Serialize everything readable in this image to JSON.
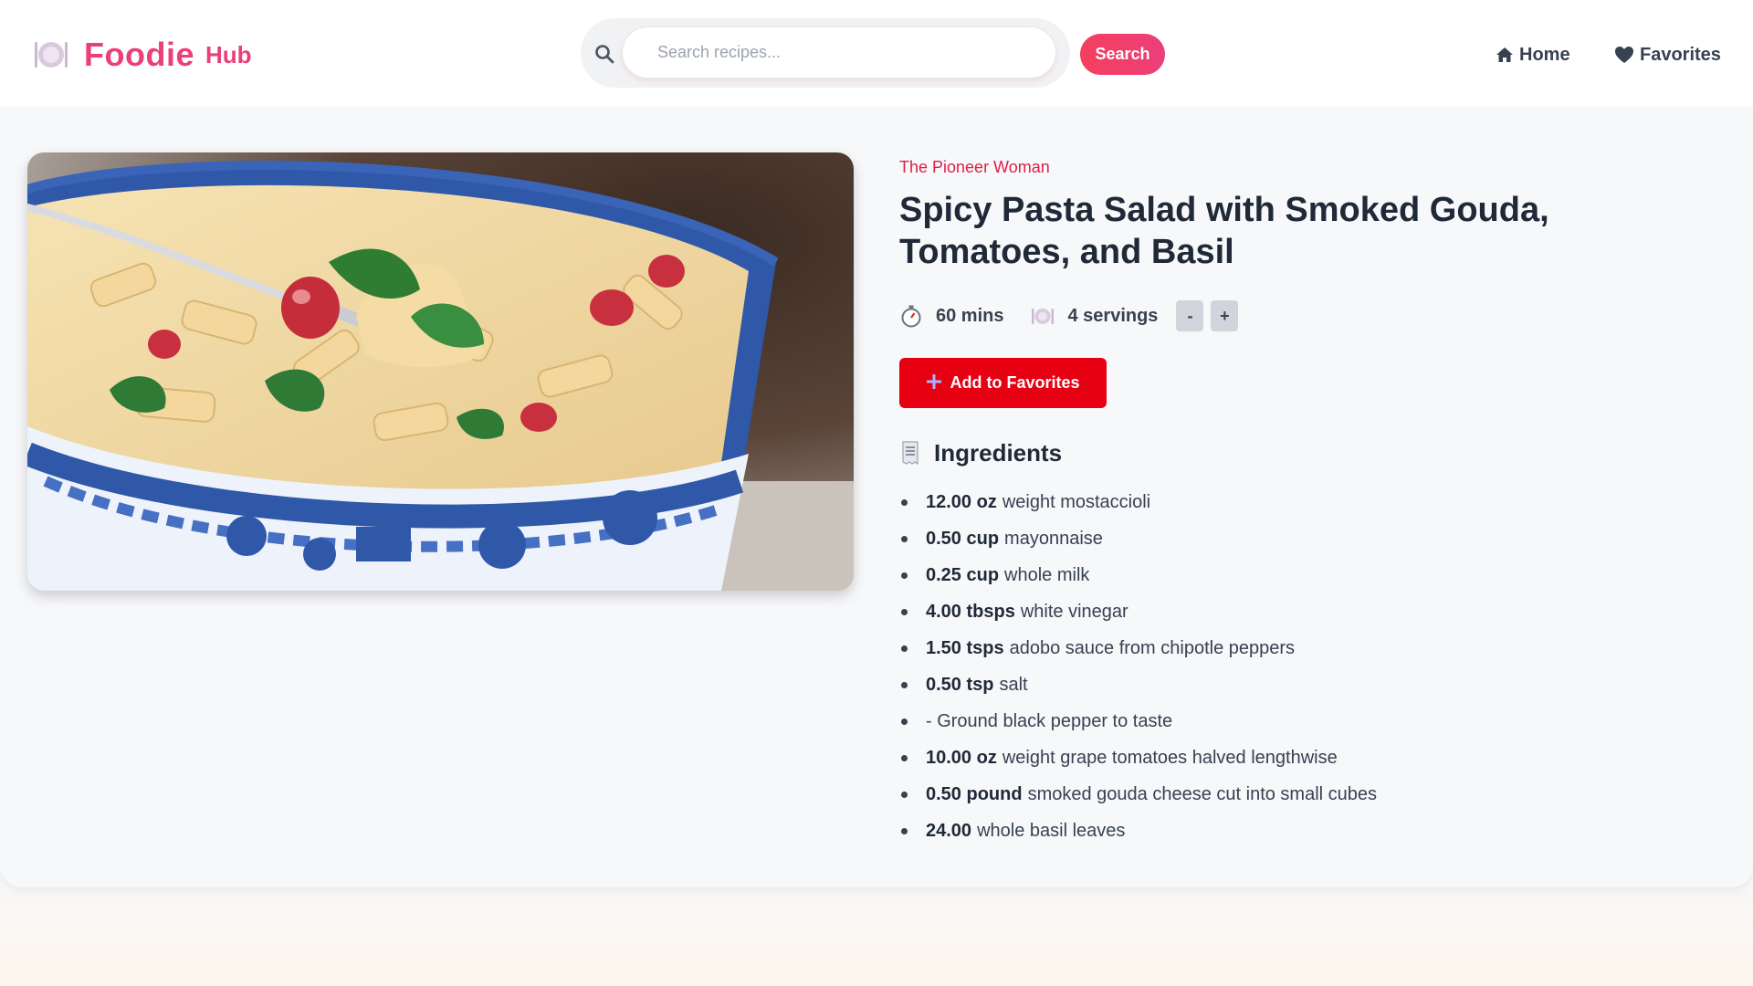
{
  "brand": {
    "name": "Foodie",
    "suffix": "Hub",
    "color": "#ec3f7a"
  },
  "search": {
    "placeholder": "Search recipes...",
    "value": "",
    "button_label": "Search"
  },
  "nav": {
    "home_label": "Home",
    "favorites_label": "Favorites"
  },
  "recipe": {
    "source": "The Pioneer Woman",
    "title": "Spicy Pasta Salad with Smoked Gouda, Tomatoes, and Basil",
    "time": "60 mins",
    "servings": "4 servings",
    "decrement_label": "-",
    "increment_label": "+",
    "favorite_button_label": "Add to Favorites",
    "ingredients_heading": "Ingredients",
    "ingredients": [
      {
        "qty": "12.00 oz",
        "name": "weight mostaccioli"
      },
      {
        "qty": "0.50 cup",
        "name": "mayonnaise"
      },
      {
        "qty": "0.25 cup",
        "name": "whole milk"
      },
      {
        "qty": "4.00 tbsps",
        "name": "white vinegar"
      },
      {
        "qty": "1.50 tsps",
        "name": "adobo sauce from chipotle peppers"
      },
      {
        "qty": "0.50 tsp",
        "name": "salt"
      },
      {
        "qty": "",
        "name": "- Ground black pepper to taste"
      },
      {
        "qty": "10.00 oz",
        "name": "weight grape tomatoes halved lengthwise"
      },
      {
        "qty": "0.50 pound",
        "name": "smoked gouda cheese cut into small cubes"
      },
      {
        "qty": "24.00",
        "name": "whole basil leaves"
      }
    ]
  },
  "colors": {
    "accent": "#ec3f7a",
    "favorite_button": "#e60012",
    "source_text": "#e11d48"
  },
  "icons": {
    "logo": "plate-icon",
    "search": "search-icon",
    "home": "home-icon",
    "favorites": "heart-icon",
    "time": "stopwatch-icon",
    "servings": "plate-icon",
    "add": "plus-icon",
    "ingredients": "receipt-icon"
  }
}
